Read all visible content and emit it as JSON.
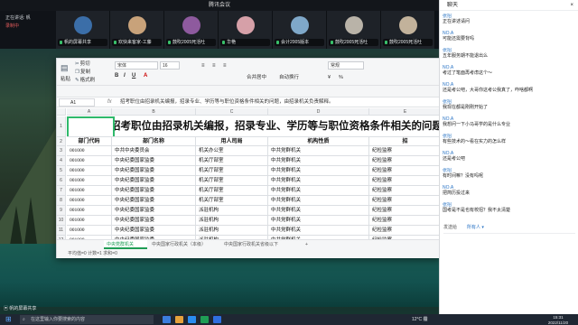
{
  "meeting": {
    "title": "腾讯会议"
  },
  "status_panel": {
    "line1": "正在讲话: 帆",
    "line2": "录制中"
  },
  "tiles": [
    {
      "name": "帆的屏幕共享",
      "color": "#3b6ea8"
    },
    {
      "name": "欢快来客家-工藤",
      "color": "#c8a27a"
    },
    {
      "name": "鼓吹2005死活吐",
      "color": "#8e5a9e"
    },
    {
      "name": "华艳",
      "color": "#d6a0a8"
    },
    {
      "name": "会计2005版本",
      "color": "#7fa8c9"
    },
    {
      "name": "鼓吹2005死活吐",
      "color": "#b9b3a8"
    },
    {
      "name": "鼓吹2005死活吐",
      "color": "#c2b29b"
    }
  ],
  "ribbon": {
    "cut": "剪切",
    "copy": "复制",
    "paste": "粘贴",
    "format_painter": "格式刷",
    "font_name": "宋体",
    "font_size": "16",
    "merge": "合并居中",
    "wrap": "自动换行",
    "currency_symbol": "¥",
    "percent_symbol": "%",
    "number_format": "常规"
  },
  "formula_bar": {
    "cell": "A1",
    "fx": "fx",
    "content": "招考职位由招录机关编报，招录专业、学历等与职位资格条件相关的问题，由招录机关负责解释。"
  },
  "sheet": {
    "columns": [
      "A",
      "B",
      "C",
      "D",
      "E"
    ],
    "title": "招考职位由招录机关编报，招录专业、学历等与职位资格条件相关的问题，由",
    "headers": [
      "部门代码",
      "部门名称",
      "用人司局",
      "机构性质",
      "招"
    ],
    "rows": [
      {
        "n": "3",
        "cells": [
          "001000",
          "中共中央委员会",
          "机关办公室",
          "中共党群机关",
          "纪检监察"
        ]
      },
      {
        "n": "4",
        "cells": [
          "001000",
          "中央纪委国家监委",
          "机关厅部室",
          "中共党群机关",
          "纪检监察"
        ]
      },
      {
        "n": "5",
        "cells": [
          "001000",
          "中央纪委国家监委",
          "机关厅部室",
          "中共党群机关",
          "纪检监察"
        ]
      },
      {
        "n": "6",
        "cells": [
          "001000",
          "中央纪委国家监委",
          "机关厅部室",
          "中共党群机关",
          "纪检监察"
        ]
      },
      {
        "n": "7",
        "cells": [
          "001000",
          "中央纪委国家监委",
          "机关厅部室",
          "中共党群机关",
          "纪检监察"
        ]
      },
      {
        "n": "8",
        "cells": [
          "001000",
          "中央纪委国家监委",
          "机关厅部室",
          "中共党群机关",
          "纪检监察"
        ]
      },
      {
        "n": "9",
        "cells": [
          "001000",
          "中央纪委国家监委",
          "派驻机构",
          "中共党群机关",
          "纪检监察"
        ]
      },
      {
        "n": "10",
        "cells": [
          "001000",
          "中央纪委国家监委",
          "派驻机构",
          "中共党群机关",
          "纪检监察"
        ]
      },
      {
        "n": "11",
        "cells": [
          "001000",
          "中央纪委国家监委",
          "派驻机构",
          "中共党群机关",
          "纪检监察"
        ]
      },
      {
        "n": "12",
        "cells": [
          "001000",
          "中央纪委国家监委",
          "派驻机构",
          "中共党群机关",
          "纪检监察"
        ]
      }
    ],
    "tabs": [
      "中央党群机关",
      "中央国家行政机关（本级）",
      "中央国家行政机关省级以下"
    ],
    "status": "平均值=0  计数=1  求和=0"
  },
  "chat": {
    "title": "聊天",
    "messages": [
      {
        "who": "张招",
        "text": "正在讲述请问"
      },
      {
        "who": "NO.A",
        "text": "可能还需要背吗"
      },
      {
        "who": "张招",
        "text": "五年服务期不能退出么"
      },
      {
        "who": "NO.A",
        "text": "考过了笔面再考虑这个～"
      },
      {
        "who": "NO.A",
        "text": "还是考公吧，大哥你这考公我真了，咋啥都啊"
      },
      {
        "who": "张招",
        "text": "我现在都是刚刚开始了"
      },
      {
        "who": "NO.A",
        "text": "我想问一下小马哥学的是什么专业"
      },
      {
        "who": "张招",
        "text": "有些技术的～看在实力的怎么样"
      },
      {
        "who": "NO.A",
        "text": "还是考公吧"
      },
      {
        "who": "张招",
        "text": "有时间嘛？没有吗呢"
      },
      {
        "who": "NO.A",
        "text": "把简历投过来"
      },
      {
        "who": "张招",
        "text": "国考是不是也有校招？我不太清楚"
      }
    ],
    "send_label": "发送给",
    "send_target": "所有人"
  },
  "taskbar": {
    "search_placeholder": "在这里输入你要搜索的内容",
    "weather": "12°C 霾",
    "time": "15:31",
    "date": "2022/11/20"
  },
  "share_note": "帆的屏幕共享"
}
